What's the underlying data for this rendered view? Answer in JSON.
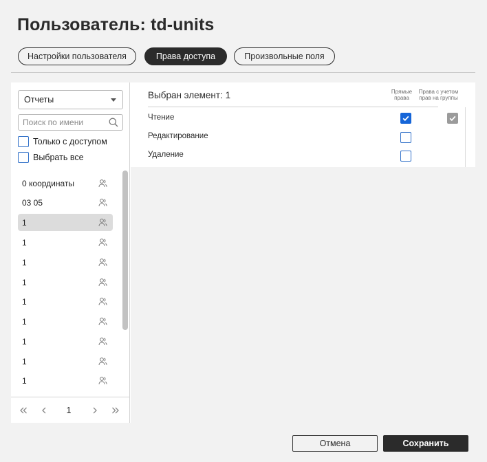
{
  "dialog": {
    "title": "Пользователь: td-units"
  },
  "tabs": [
    {
      "label": "Настройки пользователя",
      "active": false
    },
    {
      "label": "Права доступа",
      "active": true
    },
    {
      "label": "Произвольные поля",
      "active": false
    }
  ],
  "left_panel": {
    "type_select": {
      "value": "Отчеты"
    },
    "search": {
      "placeholder": "Поиск по имени",
      "value": ""
    },
    "filters": {
      "only_with_access": {
        "label": "Только с доступом",
        "checked": false
      },
      "select_all": {
        "label": "Выбрать все",
        "checked": false
      }
    },
    "items": [
      {
        "label": "0 координаты",
        "selected": false
      },
      {
        "label": "03 05",
        "selected": false
      },
      {
        "label": "1",
        "selected": true
      },
      {
        "label": "1",
        "selected": false
      },
      {
        "label": "1",
        "selected": false
      },
      {
        "label": "1",
        "selected": false
      },
      {
        "label": "1",
        "selected": false
      },
      {
        "label": "1",
        "selected": false
      },
      {
        "label": "1",
        "selected": false
      },
      {
        "label": "1",
        "selected": false
      },
      {
        "label": "1",
        "selected": false
      }
    ],
    "pagination": {
      "current_page": "1"
    }
  },
  "right_panel": {
    "selected_label": "Выбран элемент: 1",
    "columns": {
      "direct": "Прямые права",
      "with_groups": "Права с учетом прав на группы"
    },
    "permissions": [
      {
        "label": "Чтение",
        "direct": true,
        "with_groups": true
      },
      {
        "label": "Редактирование",
        "direct": false,
        "with_groups": false
      },
      {
        "label": "Удаление",
        "direct": false,
        "with_groups": false
      }
    ]
  },
  "footer": {
    "cancel_label": "Отмена",
    "save_label": "Сохранить"
  },
  "colors": {
    "accent": "#1565d8",
    "dark": "#2b2b2b",
    "selected_row": "#dcdcdc",
    "panel_bg": "#f2f2f2"
  },
  "icons": [
    "chevron-down-icon",
    "search-icon",
    "users-icon",
    "first-page-icon",
    "prev-page-icon",
    "next-page-icon",
    "last-page-icon",
    "checkmark-icon"
  ]
}
